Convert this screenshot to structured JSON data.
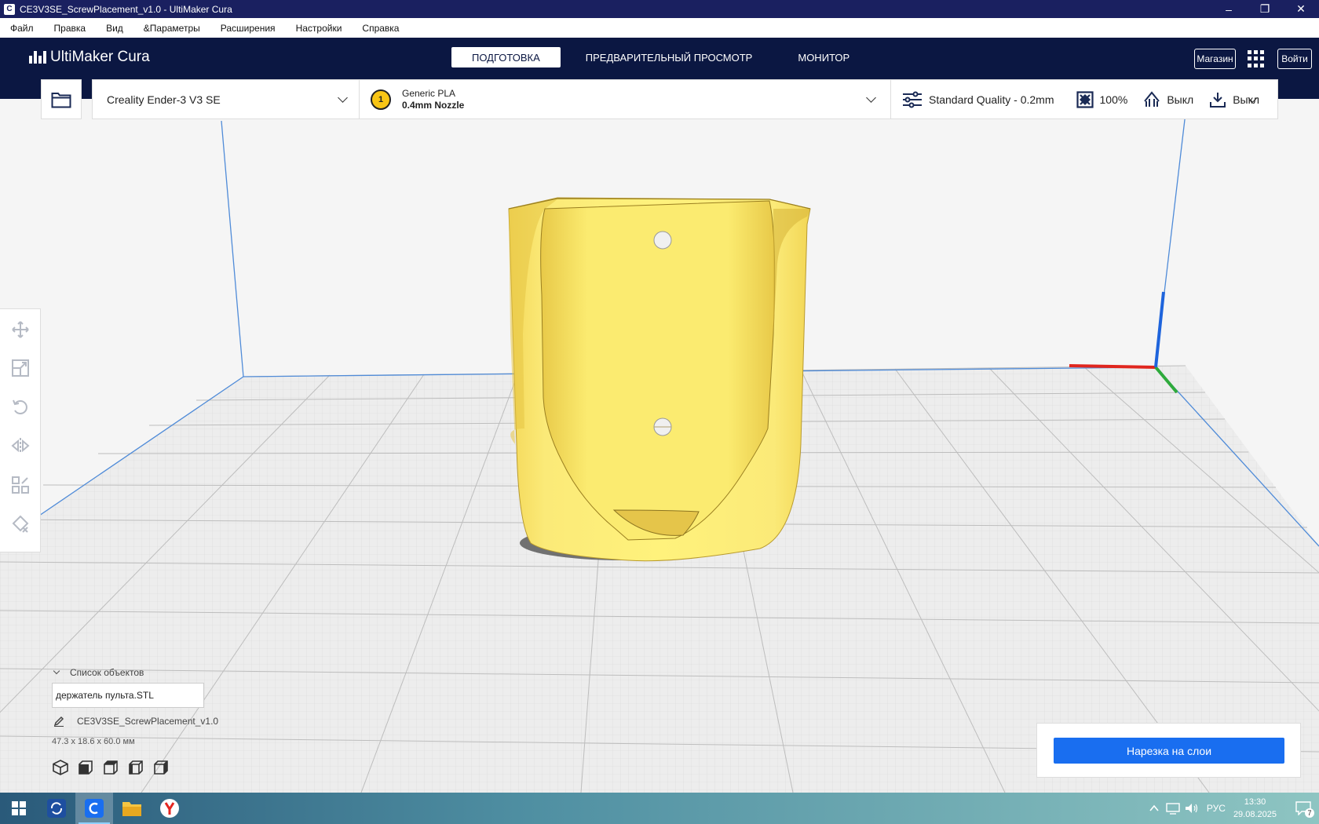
{
  "window": {
    "title": "CE3V3SE_ScrewPlacement_v1.0 - UltiMaker Cura",
    "app_icon_letter": "C",
    "minimize": "–",
    "restore": "❐",
    "close": "✕"
  },
  "menu": [
    "Файл",
    "Правка",
    "Вид",
    "&Параметры",
    "Расширения",
    "Настройки",
    "Справка"
  ],
  "header": {
    "logo": "UltiMaker Cura",
    "tabs": [
      "ПОДГОТОВКА",
      "ПРЕДВАРИТЕЛЬНЫЙ ПРОСМОТР",
      "МОНИТОР"
    ],
    "marketplace": "Магазин",
    "signin": "Войти"
  },
  "config": {
    "printer": "Creality Ender-3 V3 SE",
    "extruder_number": "1",
    "material": "Generic PLA",
    "nozzle": "0.4mm Nozzle",
    "profile": "Standard Quality - 0.2mm",
    "infill": "100%",
    "support": "Выкл",
    "adhesion": "Выкл"
  },
  "object_list": {
    "header": "Список объектов",
    "object_name": "держатель пульта.STL",
    "job_name": "CE3V3SE_ScrewPlacement_v1.0",
    "dimensions": "47.3 x 18.6 x 60.0 мм"
  },
  "slice": {
    "button": "Нарезка на слои"
  },
  "taskbar": {
    "language": "РУС",
    "time": "13:30",
    "date": "29.08.2025",
    "notification_count": "7"
  },
  "colors": {
    "header_bg": "#0b1742",
    "accent_blue": "#196ef0",
    "model_yellow": "#f8e46a"
  }
}
